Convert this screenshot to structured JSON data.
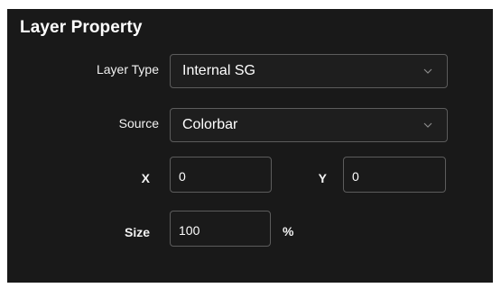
{
  "panel": {
    "title": "Layer Property"
  },
  "layer_type": {
    "label": "Layer Type",
    "value": "Internal SG"
  },
  "source": {
    "label": "Source",
    "value": "Colorbar"
  },
  "position": {
    "x_label": "X",
    "x_value": "0",
    "y_label": "Y",
    "y_value": "0"
  },
  "size": {
    "label": "Size",
    "value": "100",
    "unit": "%"
  },
  "colors": {
    "panel_background": "#191919",
    "field_border": "#5c5c5c",
    "text": "#ffffff"
  },
  "icons": {
    "dropdown": "chevron-down-icon"
  }
}
